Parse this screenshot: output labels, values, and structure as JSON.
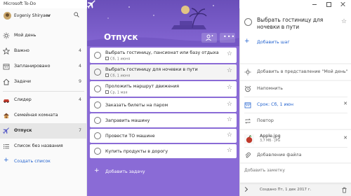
{
  "window": {
    "title": "Microsoft To-Do"
  },
  "user": {
    "name": "Evgeniy Shiryaev"
  },
  "sidebar": {
    "items": [
      {
        "label": "Мой день",
        "count": "",
        "icon": "sun-icon"
      },
      {
        "label": "Важно",
        "count": "4",
        "icon": "star-icon"
      },
      {
        "label": "Запланировано",
        "count": "4",
        "icon": "calendar-icon"
      },
      {
        "label": "Задачи",
        "count": "9",
        "icon": "home-icon"
      }
    ],
    "lists": [
      {
        "label": "Слидер",
        "count": "4",
        "icon": "car-icon"
      },
      {
        "label": "Семейная комната",
        "count": "",
        "icon": "house-icon"
      },
      {
        "label": "Отпуск",
        "count": "7",
        "icon": "airplane-icon",
        "active": true
      },
      {
        "label": "Список без названия",
        "count": "",
        "icon": "list-icon"
      }
    ],
    "create_list": "Создать список"
  },
  "main": {
    "title": "Отпуск",
    "tasks": [
      {
        "title": "Выбрать гостиницу, пансионат или базу отдыха",
        "sub": "Сб, 1 июня"
      },
      {
        "title": "Выбрать гостиницу для ночевки в пути",
        "sub": "Сб, 1 июня",
        "selected": true
      },
      {
        "title": "Проложить маршрут движения",
        "sub": "Ср, 1 мая"
      },
      {
        "title": "Заказать билеты на паром",
        "sub": ""
      },
      {
        "title": "Заправить машину",
        "sub": ""
      },
      {
        "title": "Провести ТО машине",
        "sub": ""
      },
      {
        "title": "Купить продукты в дорогу",
        "sub": ""
      }
    ],
    "add_task": "Добавить задачу"
  },
  "detail": {
    "title": "Выбрать гостиницу для ночевки в пути",
    "add_step": "Добавить шаг",
    "add_to_my_day": "Добавить в представление \"Мой день\"",
    "remind": "Напомнить",
    "due": "Срок: Сб, 1 июн",
    "repeat": "Повтор",
    "file": {
      "name": "Apple.jpg",
      "meta": "3,7 МБ · JPG"
    },
    "add_file": "Добавление файла",
    "add_note": "Добавить заметку",
    "created": "Создано Пт, 1 дек 2017 г."
  },
  "colors": {
    "accent": "#2564cf",
    "list_theme": "#8a6bd6"
  }
}
